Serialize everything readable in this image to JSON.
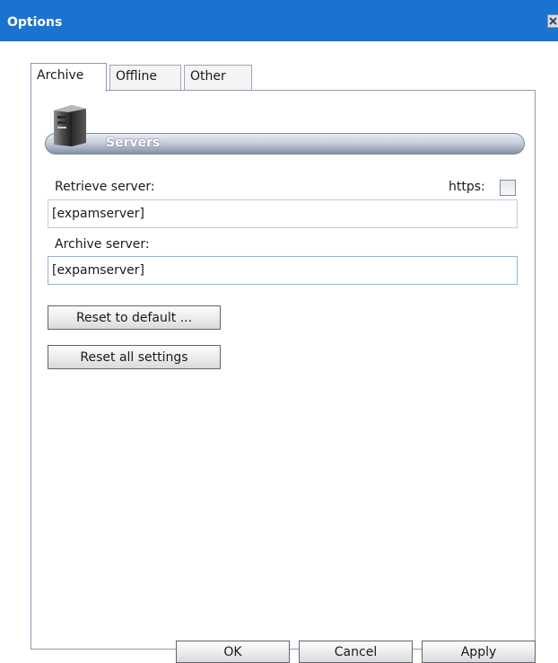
{
  "window": {
    "title": "Options"
  },
  "tabs": [
    {
      "label": "Archive",
      "active": true
    },
    {
      "label": "Offline",
      "active": false
    },
    {
      "label": "Other",
      "active": false
    }
  ],
  "servers_group": {
    "title": "Servers",
    "icon": "server-tower-icon",
    "retrieve_label": "Retrieve server:",
    "retrieve_value": "[expamserver]",
    "https_label": "https:",
    "https_checked": false,
    "archive_label": "Archive server:",
    "archive_value": "[expamserver]"
  },
  "actions": {
    "reset_default_label": "Reset to default ...",
    "reset_all_label": "Reset all settings"
  },
  "footer": {
    "ok_label": "OK",
    "cancel_label": "Cancel",
    "apply_label": "Apply"
  },
  "colors": {
    "titlebar": "#1a73cf",
    "panel_border": "#8f9bb0"
  }
}
